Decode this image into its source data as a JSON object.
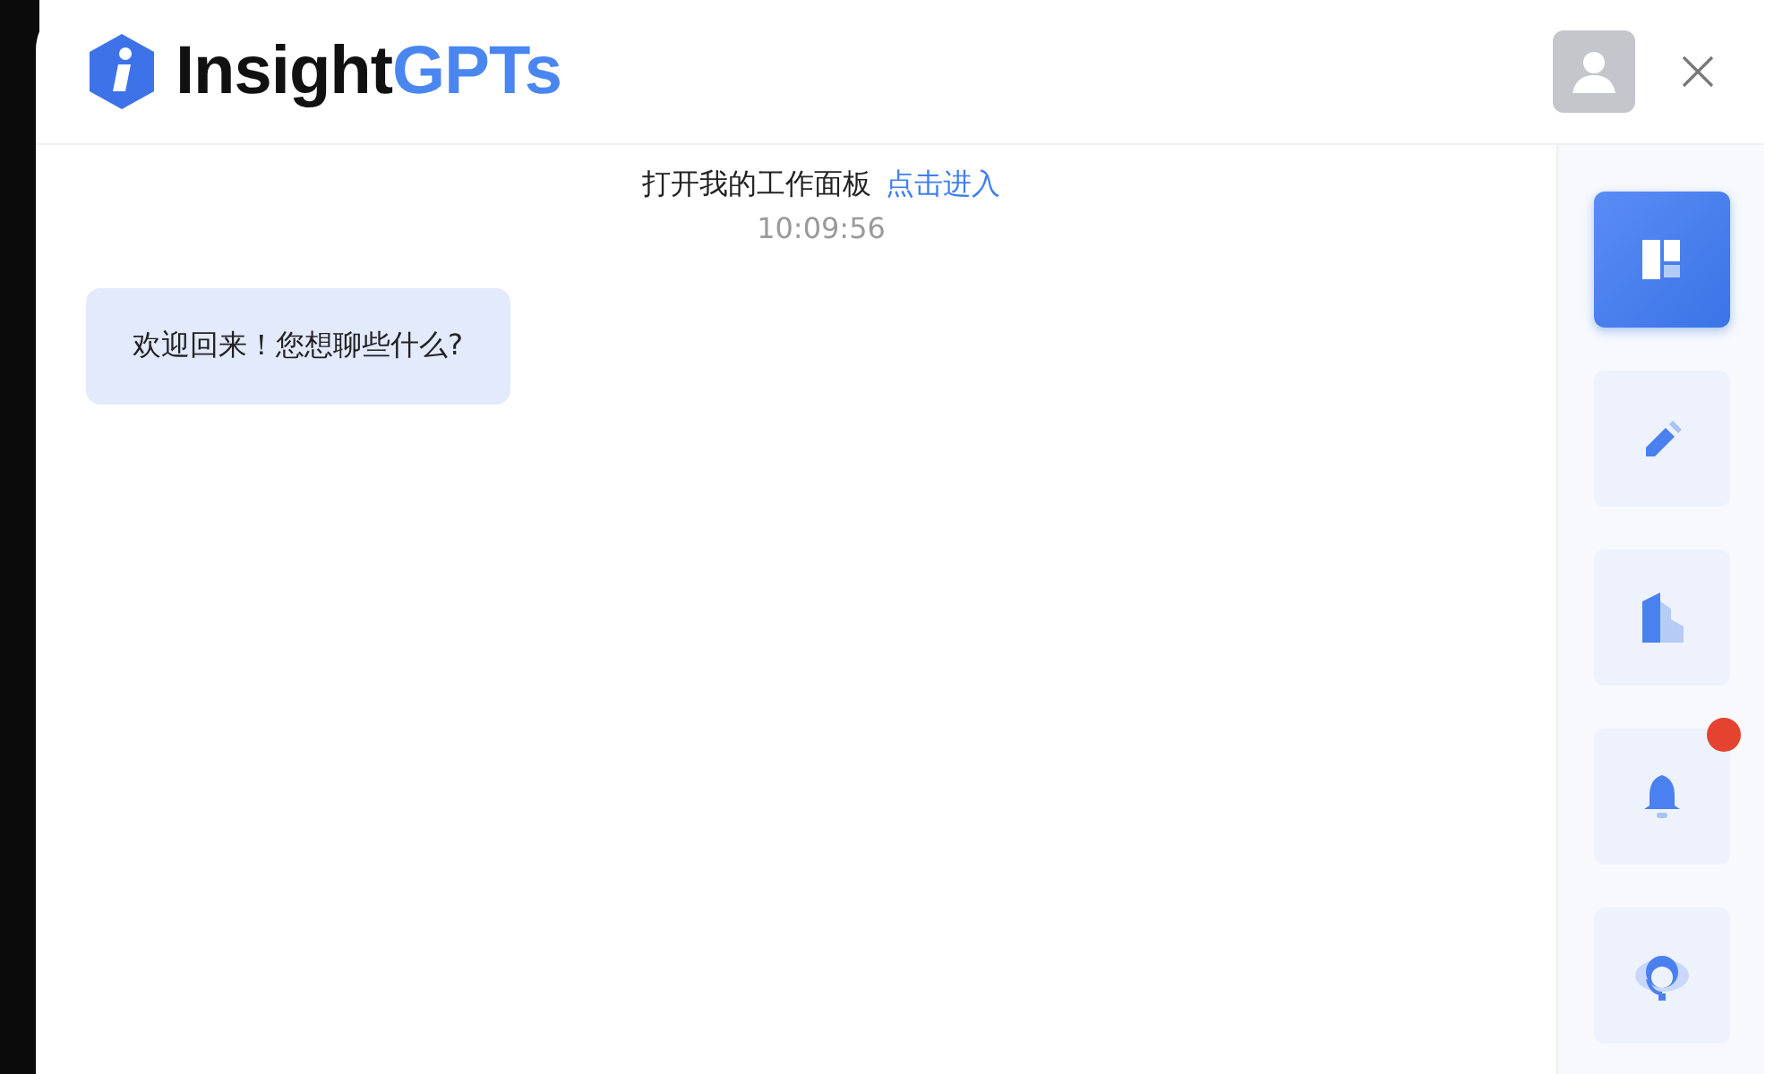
{
  "header": {
    "brand": "Insight",
    "brand_accent": "GPTs"
  },
  "notice": {
    "text": "打开我的工作面板",
    "link": "点击进入",
    "time": "10:09:56"
  },
  "messages": [
    {
      "text": "欢迎回来！您想聊些什么?"
    }
  ],
  "sidebar": {
    "items": [
      {
        "kind": "board",
        "selected": true,
        "badge": false
      },
      {
        "kind": "edit",
        "selected": false,
        "badge": false
      },
      {
        "kind": "building",
        "selected": false,
        "badge": false
      },
      {
        "kind": "bell",
        "selected": false,
        "badge": true
      },
      {
        "kind": "support",
        "selected": false,
        "badge": false
      }
    ]
  }
}
